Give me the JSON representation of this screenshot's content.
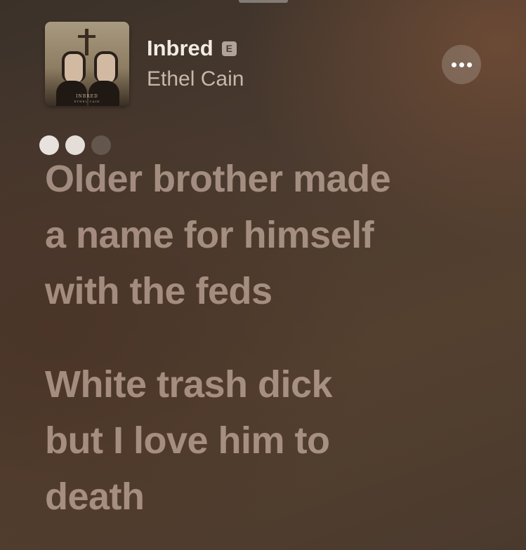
{
  "now_playing": {
    "title": "Inbred",
    "explicit_badge": "E",
    "artist": "Ethel Cain",
    "artwork": {
      "cover_title": "INBRED",
      "cover_artist": "ETHEL CAIN"
    }
  },
  "menu": {
    "icon": "more-horizontal-icon"
  },
  "lyrics": [
    {
      "lines": [
        "Older brother made",
        "a name for himself",
        "with the feds"
      ]
    },
    {
      "lines": [
        "White trash dick",
        "but I love him to",
        "death"
      ]
    }
  ],
  "colors": {
    "lyric_text": "#c9b2a3",
    "title_text": "#f3ebe3",
    "artist_text": "#c8b8a8",
    "background": "#4a3a2f"
  }
}
